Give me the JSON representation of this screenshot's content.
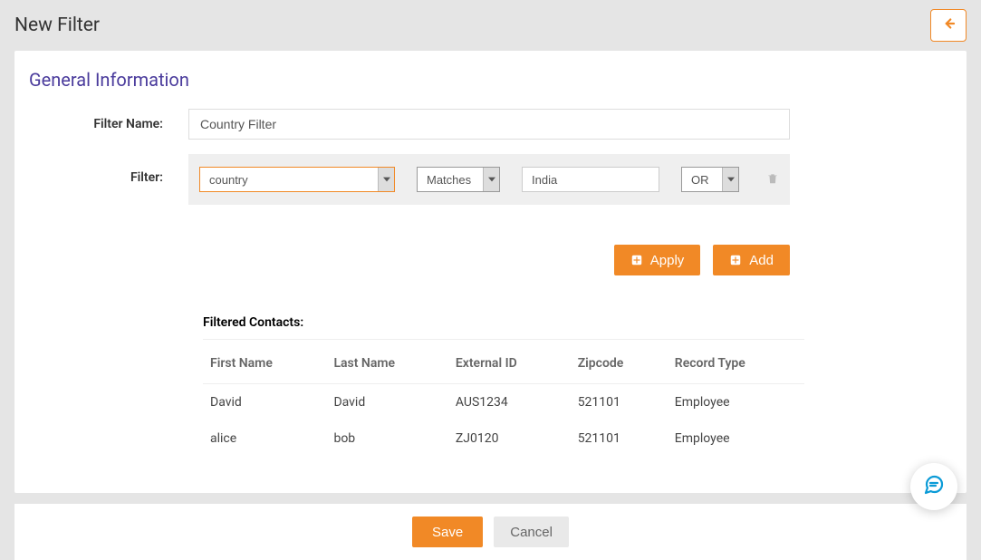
{
  "page": {
    "title": "New Filter"
  },
  "section": {
    "title": "General Information"
  },
  "form": {
    "filter_name_label": "Filter Name:",
    "filter_name_value": "Country Filter",
    "filter_label": "Filter:"
  },
  "filter_rule": {
    "field": "country",
    "operator": "Matches",
    "value": "India",
    "conjunction": "OR"
  },
  "actions": {
    "apply": "Apply",
    "add": "Add"
  },
  "filtered": {
    "heading": "Filtered Contacts:",
    "columns": [
      "First Name",
      "Last Name",
      "External ID",
      "Zipcode",
      "Record Type"
    ],
    "rows": [
      {
        "first_name": "David",
        "last_name": "David",
        "external_id": "AUS1234",
        "zipcode": "521101",
        "record_type": "Employee"
      },
      {
        "first_name": "alice",
        "last_name": "bob",
        "external_id": "ZJ0120",
        "zipcode": "521101",
        "record_type": "Employee"
      }
    ]
  },
  "footer": {
    "save": "Save",
    "cancel": "Cancel"
  }
}
